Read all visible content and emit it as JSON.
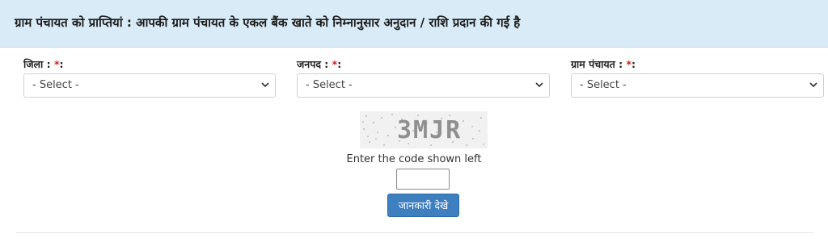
{
  "header": {
    "title": "ग्राम पंचायत को प्राप्तियां : आपकी ग्राम पंचायत के एकल बैंक खाते को निम्नानुसार अनुदान / राशि प्रदान की गई है"
  },
  "form": {
    "district": {
      "label": "जिला :",
      "required_mark": "*",
      "suffix": ":",
      "value": "- Select -"
    },
    "janpad": {
      "label": "जनपद :",
      "required_mark": "*",
      "suffix": ":",
      "value": "- Select -"
    },
    "gram_panchayat": {
      "label": "ग्राम पंचायत :",
      "required_mark": "*",
      "suffix": ":",
      "value": "- Select -"
    }
  },
  "captcha": {
    "code": "3MJR",
    "instruction": "Enter the code shown left",
    "input_value": ""
  },
  "submit_label": "जानकारी देखे",
  "colors": {
    "header_bg": "#d8ebf6",
    "required": "#d21c1c",
    "button_bg": "#3d7fbf"
  }
}
